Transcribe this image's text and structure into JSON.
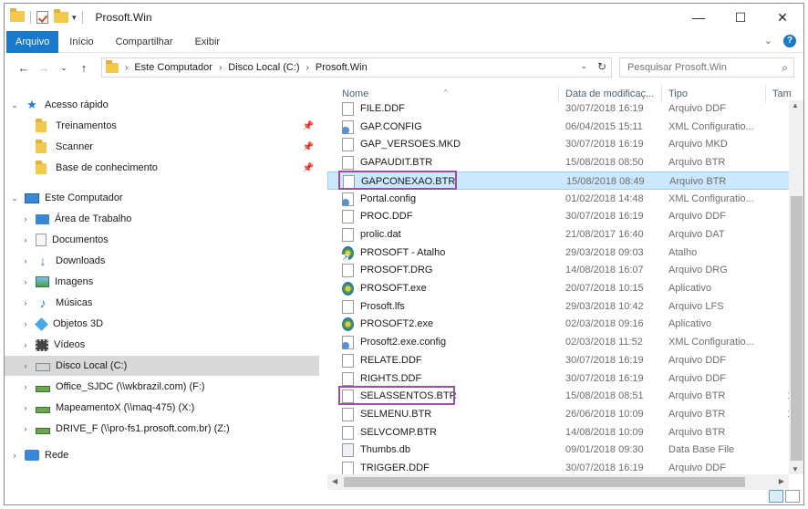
{
  "window": {
    "title": "Prosoft.Win",
    "controls": {
      "minimize": "—",
      "maximize": "☐",
      "close": "✕"
    }
  },
  "ribbon": {
    "tabs": [
      "Arquivo",
      "Início",
      "Compartilhar",
      "Exibir"
    ]
  },
  "address": {
    "crumbs": [
      "Este Computador",
      "Disco Local (C:)",
      "Prosoft.Win"
    ],
    "search_placeholder": "Pesquisar Prosoft.Win"
  },
  "sidebar": {
    "quick_access": "Acesso rápido",
    "quick_items": [
      "Treinamentos",
      "Scanner",
      "Base de conhecimento"
    ],
    "this_pc": "Este Computador",
    "pc_items": [
      "Área de Trabalho",
      "Documentos",
      "Downloads",
      "Imagens",
      "Músicas",
      "Objetos 3D",
      "Vídeos",
      "Disco Local (C:)",
      "Office_SJDC (\\\\wkbrazil.com) (F:)",
      "MapeamentoX (\\\\maq-475) (X:)",
      "DRIVE_F (\\\\pro-fs1.prosoft.com.br) (Z:)"
    ],
    "network": "Rede"
  },
  "columns": {
    "name": "Nome",
    "date": "Data de modificaç...",
    "type": "Tipo",
    "size": "Tam"
  },
  "files": [
    {
      "name": "FILE.DDF",
      "date": "30/07/2018 16:19",
      "type": "Arquivo DDF",
      "size": "",
      "icon": "doc"
    },
    {
      "name": "GAP.CONFIG",
      "date": "06/04/2015 15:11",
      "type": "XML Configuratio...",
      "size": "",
      "icon": "cfg"
    },
    {
      "name": "GAP_VERSOES.MKD",
      "date": "30/07/2018 16:19",
      "type": "Arquivo MKD",
      "size": "",
      "icon": "doc"
    },
    {
      "name": "GAPAUDIT.BTR",
      "date": "15/08/2018 08:50",
      "type": "Arquivo BTR",
      "size": "",
      "icon": "doc"
    },
    {
      "name": "GAPCONEXAO.BTR",
      "date": "15/08/2018 08:49",
      "type": "Arquivo BTR",
      "size": "",
      "icon": "doc"
    },
    {
      "name": "Portal.config",
      "date": "01/02/2018 14:48",
      "type": "XML Configuratio...",
      "size": "",
      "icon": "cfg"
    },
    {
      "name": "PROC.DDF",
      "date": "30/07/2018 16:19",
      "type": "Arquivo DDF",
      "size": "",
      "icon": "doc"
    },
    {
      "name": "prolic.dat",
      "date": "21/08/2017 16:40",
      "type": "Arquivo DAT",
      "size": "",
      "icon": "doc"
    },
    {
      "name": "PROSOFT - Atalho",
      "date": "29/03/2018 09:03",
      "type": "Atalho",
      "size": "",
      "icon": "link"
    },
    {
      "name": "PROSOFT.DRG",
      "date": "14/08/2018 16:07",
      "type": "Arquivo DRG",
      "size": "",
      "icon": "doc"
    },
    {
      "name": "PROSOFT.exe",
      "date": "20/07/2018 10:15",
      "type": "Aplicativo",
      "size": "",
      "icon": "app"
    },
    {
      "name": "Prosoft.lfs",
      "date": "29/03/2018 10:42",
      "type": "Arquivo LFS",
      "size": "",
      "icon": "doc"
    },
    {
      "name": "PROSOFT2.exe",
      "date": "02/03/2018 09:16",
      "type": "Aplicativo",
      "size": "",
      "icon": "app"
    },
    {
      "name": "Prosoft2.exe.config",
      "date": "02/03/2018 11:52",
      "type": "XML Configuratio...",
      "size": "",
      "icon": "cfg"
    },
    {
      "name": "RELATE.DDF",
      "date": "30/07/2018 16:19",
      "type": "Arquivo DDF",
      "size": "",
      "icon": "doc"
    },
    {
      "name": "RIGHTS.DDF",
      "date": "30/07/2018 16:19",
      "type": "Arquivo DDF",
      "size": "",
      "icon": "doc"
    },
    {
      "name": "SELASSENTOS.BTR",
      "date": "15/08/2018 08:51",
      "type": "Arquivo BTR",
      "size": "1",
      "icon": "doc"
    },
    {
      "name": "SELMENU.BTR",
      "date": "26/06/2018 10:09",
      "type": "Arquivo BTR",
      "size": "1",
      "icon": "doc"
    },
    {
      "name": "SELVCOMP.BTR",
      "date": "14/08/2018 10:09",
      "type": "Arquivo BTR",
      "size": "",
      "icon": "doc"
    },
    {
      "name": "Thumbs.db",
      "date": "09/01/2018 09:30",
      "type": "Data Base File",
      "size": "",
      "icon": "thumb"
    },
    {
      "name": "TRIGGER.DDF",
      "date": "30/07/2018 16:19",
      "type": "Arquivo DDF",
      "size": "",
      "icon": "doc"
    }
  ],
  "selected_file": "GAPCONEXAO.BTR",
  "highlighted_files": [
    "GAPCONEXAO.BTR",
    "SELASSENTOS.BTR"
  ],
  "colors": {
    "accent": "#1979ca",
    "selection": "#cce8ff",
    "highlight_box": "#9b4ea8"
  }
}
